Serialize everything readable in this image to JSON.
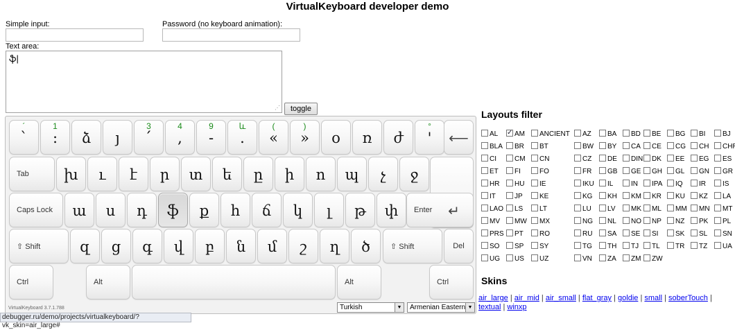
{
  "page": {
    "title": "VirtualKeyboard developer demo"
  },
  "form": {
    "simple_input_label": "Simple input:",
    "password_label": "Password (no keyboard animation):",
    "textarea_label": "Text area:",
    "textarea_value": "ֆ|",
    "toggle_label": "toggle"
  },
  "keyboard": {
    "row1": [
      {
        "main": "`",
        "alt": "´"
      },
      {
        "main": ":",
        "alt": "1"
      },
      {
        "main": "ձ",
        "alt": ""
      },
      {
        "main": "յ",
        "alt": ""
      },
      {
        "main": "՛",
        "alt": "3"
      },
      {
        "main": ",",
        "alt": "4"
      },
      {
        "main": "-",
        "alt": "9"
      },
      {
        "main": ".",
        "alt": "և"
      },
      {
        "main": "«",
        "alt": "("
      },
      {
        "main": "»",
        "alt": ")"
      },
      {
        "main": "օ",
        "alt": ""
      },
      {
        "main": "ռ",
        "alt": ""
      },
      {
        "main": "ժ",
        "alt": ""
      },
      {
        "main": "'",
        "alt": "°"
      }
    ],
    "backspace_icon": "backspace-arrow-icon",
    "tab_label": "Tab",
    "row2": [
      "խ",
      "ւ",
      "է",
      "ր",
      "տ",
      "ե",
      "ը",
      "ի",
      "ո",
      "պ",
      "չ",
      "ջ"
    ],
    "caps_label": "Caps Lock",
    "row3": [
      "ա",
      "ս",
      "դ",
      "ֆ",
      "ք",
      "հ",
      "ճ",
      "կ",
      "լ",
      "թ",
      "փ"
    ],
    "enter_label": "Enter",
    "shift_label": "Shift",
    "row4": [
      "զ",
      "ց",
      "գ",
      "վ",
      "բ",
      "ն",
      "մ",
      "շ",
      "ղ",
      "ծ"
    ],
    "del_label": "Del",
    "ctrl_label": "Ctrl",
    "alt_label": "Alt",
    "version": "VirtualKeyboard 3.7.1.788",
    "lang_select": "Turkish",
    "layout_select": "Armenian Eastern"
  },
  "status_bar": "debugger.ru/demo/projects/virtualkeyboard/?vk_skin=air_large#",
  "filter": {
    "heading": "Layouts filter",
    "items": [
      [
        "AL",
        "AM",
        "ANCIENT",
        "AZ",
        "BA",
        "BD",
        "BE",
        "BG",
        "BI",
        "BJ"
      ],
      [
        "BLA",
        "BR",
        "BT",
        "BW",
        "BY",
        "CA",
        "CE",
        "CG",
        "CH",
        "CHR"
      ],
      [
        "CI",
        "CM",
        "CN",
        "CZ",
        "DE",
        "DIN",
        "DK",
        "EE",
        "EG",
        "ES"
      ],
      [
        "ET",
        "FI",
        "FO",
        "FR",
        "GB",
        "GE",
        "GH",
        "GL",
        "GN",
        "GR"
      ],
      [
        "HR",
        "HU",
        "IE",
        "IKU",
        "IL",
        "IN",
        "IPA",
        "IQ",
        "IR",
        "IS"
      ],
      [
        "IT",
        "JP",
        "KE",
        "KG",
        "KH",
        "KM",
        "KR",
        "KU",
        "KZ",
        "LA"
      ],
      [
        "LAO",
        "LS",
        "LT",
        "LU",
        "LV",
        "MK",
        "ML",
        "MM",
        "MN",
        "MT"
      ],
      [
        "MV",
        "MW",
        "MX",
        "NG",
        "NL",
        "NO",
        "NP",
        "NZ",
        "PK",
        "PL"
      ],
      [
        "PRS",
        "PT",
        "RO",
        "RU",
        "SA",
        "SE",
        "SI",
        "SK",
        "SL",
        "SN"
      ],
      [
        "SO",
        "SP",
        "SY",
        "TG",
        "TH",
        "TJ",
        "TL",
        "TR",
        "TZ",
        "UA"
      ],
      [
        "UG",
        "US",
        "UZ",
        "VN",
        "ZA",
        "ZM",
        "ZW"
      ]
    ],
    "checked": "AM"
  },
  "skins": {
    "heading": "Skins",
    "links": [
      "air_large",
      "air_mid",
      "air_small",
      "flat_gray",
      "goldie",
      "small",
      "soberTouch",
      "textual",
      "winxp"
    ]
  }
}
